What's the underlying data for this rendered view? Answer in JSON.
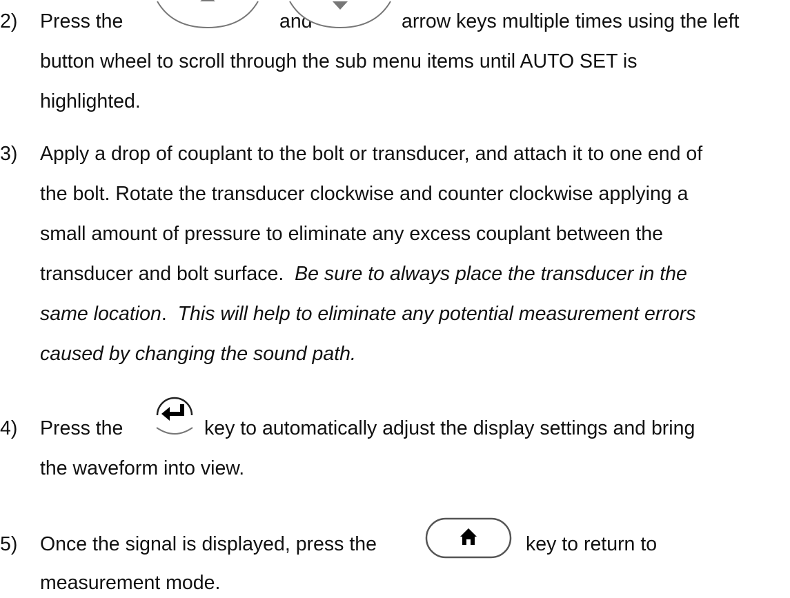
{
  "steps": [
    {
      "number": "2)",
      "pre_text": "Press the",
      "and_text": "and",
      "post_text": "arrow keys multiple times using the left",
      "lines": [
        "button wheel to scroll through the sub menu items until AUTO SET is",
        "highlighted."
      ],
      "icons": [
        "up-arrow-key-icon",
        "down-arrow-key-icon"
      ]
    },
    {
      "number": "3)",
      "lines": [
        "Apply a drop of couplant to the bolt or transducer, and attach it to one end of",
        "the bolt.  Rotate the transducer clockwise and counter clockwise applying a",
        "small amount of pressure to eliminate any excess couplant between the"
      ],
      "line4_normal": "transducer and bolt surface.",
      "line4_italic": "Be sure to always place the transducer in the",
      "line5_italic": "same location",
      "line5_normal": ".",
      "line5_italic2": "This will help to eliminate any potential measurement errors",
      "line6_italic": "caused by changing the sound path."
    },
    {
      "number": "4)",
      "pre_text": "Press the",
      "post_text": "key to automatically adjust the display settings and bring",
      "lines": [
        "the waveform into view."
      ],
      "icons": [
        "enter-key-icon"
      ]
    },
    {
      "number": "5)",
      "pre_text": "Once the signal is displayed, press the",
      "post_text": "key to return to",
      "lines": [
        "measurement mode."
      ],
      "icons": [
        "home-key-icon"
      ]
    }
  ]
}
